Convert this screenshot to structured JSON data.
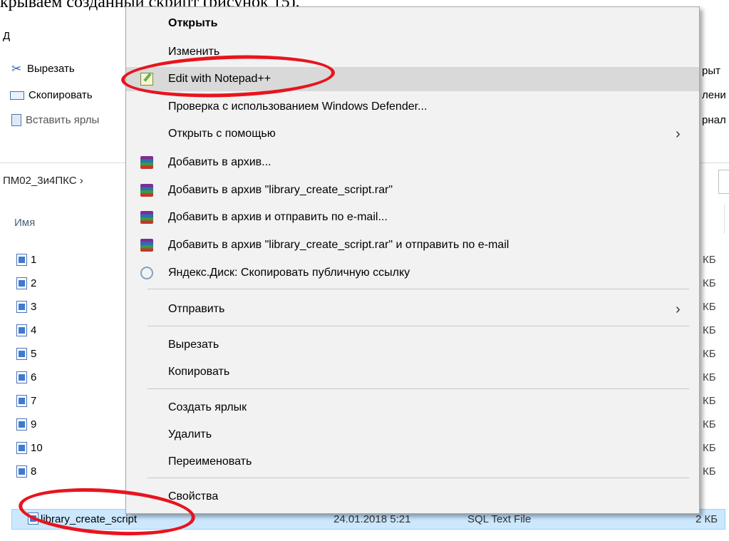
{
  "doc": {
    "caption": "крываем созданный скрипт (рисунок 15)."
  },
  "explorer": {
    "tab_letter": "Д",
    "ribbon": {
      "cut": "Вырезать",
      "copy": "Скопировать",
      "paste_shortcut": "Вставить ярлы",
      "frag1": "рыт",
      "frag2": "лени",
      "frag3": "рнал"
    },
    "address": "ПМ02_3и4ПКС  ›",
    "column_name": "Имя",
    "files": [
      {
        "name": "1",
        "size": "КБ"
      },
      {
        "name": "2",
        "size": "КБ"
      },
      {
        "name": "3",
        "size": "КБ"
      },
      {
        "name": "4",
        "size": "КБ"
      },
      {
        "name": "5",
        "size": "КБ"
      },
      {
        "name": "6",
        "size": "КБ"
      },
      {
        "name": "7",
        "size": "КБ"
      },
      {
        "name": "9",
        "size": "КБ"
      },
      {
        "name": "10",
        "size": "КБ"
      },
      {
        "name": "8",
        "size": "КБ"
      }
    ],
    "selected": {
      "name": "library_create_script",
      "date": "24.01.2018 5:21",
      "type": "SQL Text File",
      "size": "2 КБ"
    }
  },
  "menu": {
    "items": [
      {
        "label": "Открыть",
        "icon": ""
      },
      {
        "label": "Изменить",
        "icon": ""
      },
      {
        "label": "Edit with Notepad++",
        "icon": "notepadpp-icon"
      },
      {
        "label": "Проверка с использованием Windows Defender...",
        "icon": ""
      },
      {
        "label": "Открыть с помощью",
        "icon": ""
      },
      {
        "label": "Добавить в архив...",
        "icon": "winrar-icon"
      },
      {
        "label": "Добавить в архив \"library_create_script.rar\"",
        "icon": "winrar-icon"
      },
      {
        "label": "Добавить в архив и отправить по e-mail...",
        "icon": "winrar-icon"
      },
      {
        "label": "Добавить в архив \"library_create_script.rar\" и отправить по e-mail",
        "icon": "winrar-icon"
      },
      {
        "label": "Яндекс.Диск: Скопировать публичную ссылку",
        "icon": "yandex-disk-icon"
      },
      {
        "label": "Отправить",
        "icon": ""
      },
      {
        "label": "Вырезать",
        "icon": ""
      },
      {
        "label": "Копировать",
        "icon": ""
      },
      {
        "label": "Создать ярлык",
        "icon": ""
      },
      {
        "label": "Удалить",
        "icon": ""
      },
      {
        "label": "Переименовать",
        "icon": ""
      },
      {
        "label": "Свойства",
        "icon": ""
      }
    ],
    "submenu_arrow": "›"
  },
  "colors": {
    "highlight": "#d9d9d9",
    "annotation": "#e8141e",
    "selection": "#cce8ff"
  }
}
